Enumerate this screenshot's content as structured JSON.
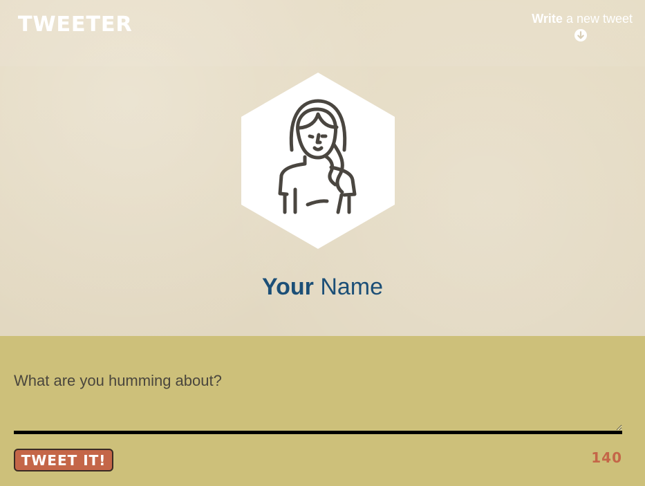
{
  "app": {
    "title": "TWEETER"
  },
  "nav": {
    "write_bold": "Write",
    "write_rest": " a new tweet",
    "icon": "arrow-down-circle-icon"
  },
  "profile": {
    "avatar_icon": "user-avatar-icon",
    "first_name": "Your",
    "last_name": " Name"
  },
  "composer": {
    "placeholder": "What are you humming about?",
    "value": "",
    "button_label": "TWEET IT!",
    "char_count": "140"
  },
  "colors": {
    "background": "#e5dbc3",
    "composer_background": "#cdc07a",
    "name_color": "#1c4f77",
    "accent": "#c46648",
    "white": "#ffffff"
  }
}
